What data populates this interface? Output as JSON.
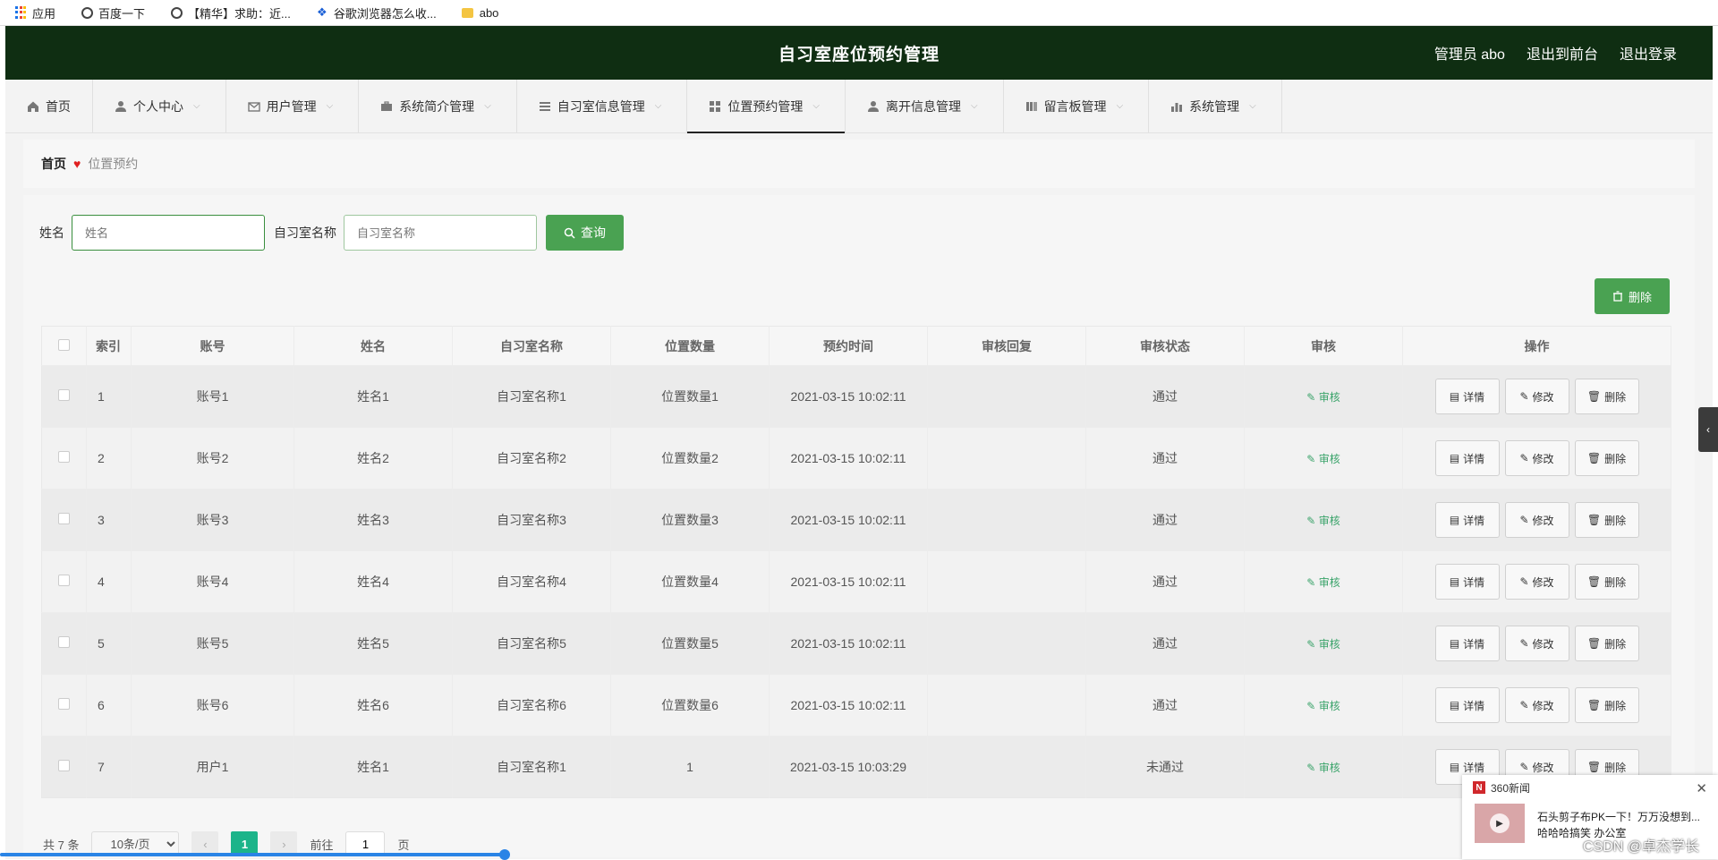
{
  "bookmarks": [
    "应用",
    "百度一下",
    "【精华】求助：近...",
    "谷歌浏览器怎么收...",
    "abo"
  ],
  "header": {
    "title": "自习室座位预约管理",
    "user": "管理员 abo",
    "front": "退出到前台",
    "logout": "退出登录"
  },
  "nav": [
    {
      "label": "首页",
      "icon": "home-icon"
    },
    {
      "label": "个人中心",
      "icon": "user-icon"
    },
    {
      "label": "用户管理",
      "icon": "mail-icon"
    },
    {
      "label": "系统简介管理",
      "icon": "briefcase-icon"
    },
    {
      "label": "自习室信息管理",
      "icon": "list-icon"
    },
    {
      "label": "位置预约管理",
      "icon": "grid-icon"
    },
    {
      "label": "离开信息管理",
      "icon": "user-icon"
    },
    {
      "label": "留言板管理",
      "icon": "board-icon"
    },
    {
      "label": "系统管理",
      "icon": "bar-chart-icon"
    }
  ],
  "breadcrumb": {
    "home": "首页",
    "current": "位置预约"
  },
  "search": {
    "name_label": "姓名",
    "name_placeholder": "姓名",
    "room_label": "自习室名称",
    "room_placeholder": "自习室名称",
    "query_button": "查询"
  },
  "delete_button": "删除",
  "table": {
    "headers": [
      "索引",
      "账号",
      "姓名",
      "自习室名称",
      "位置数量",
      "预约时间",
      "审核回复",
      "审核状态",
      "审核",
      "操作"
    ],
    "rows": [
      [
        "1",
        "账号1",
        "姓名1",
        "自习室名称1",
        "位置数量1",
        "2021-03-15 10:02:11",
        "",
        "通过"
      ],
      [
        "2",
        "账号2",
        "姓名2",
        "自习室名称2",
        "位置数量2",
        "2021-03-15 10:02:11",
        "",
        "通过"
      ],
      [
        "3",
        "账号3",
        "姓名3",
        "自习室名称3",
        "位置数量3",
        "2021-03-15 10:02:11",
        "",
        "通过"
      ],
      [
        "4",
        "账号4",
        "姓名4",
        "自习室名称4",
        "位置数量4",
        "2021-03-15 10:02:11",
        "",
        "通过"
      ],
      [
        "5",
        "账号5",
        "姓名5",
        "自习室名称5",
        "位置数量5",
        "2021-03-15 10:02:11",
        "",
        "通过"
      ],
      [
        "6",
        "账号6",
        "姓名6",
        "自习室名称6",
        "位置数量6",
        "2021-03-15 10:02:11",
        "",
        "通过"
      ],
      [
        "7",
        "用户1",
        "姓名1",
        "自习室名称1",
        "1",
        "2021-03-15 10:03:29",
        "",
        "未通过"
      ]
    ],
    "audit_label": "审核",
    "detail_label": "详情",
    "edit_label": "修改",
    "delete_label": "删除"
  },
  "pagination": {
    "total": "共 7 条",
    "page_size": "10条/页",
    "current_page": "1",
    "goto_prefix": "前往",
    "goto_value": "1",
    "goto_suffix": "页"
  },
  "news_popup": {
    "source": "360新闻",
    "line1": "石头剪子布PK一下！万万没想到...",
    "line2": "哈哈哈搞笑 办公室"
  },
  "watermark": "CSDN @卓杰学长",
  "colors": {
    "header_bg": "#0f2e12",
    "primary_green": "#4aa252",
    "pager_active": "#1cb48a"
  }
}
